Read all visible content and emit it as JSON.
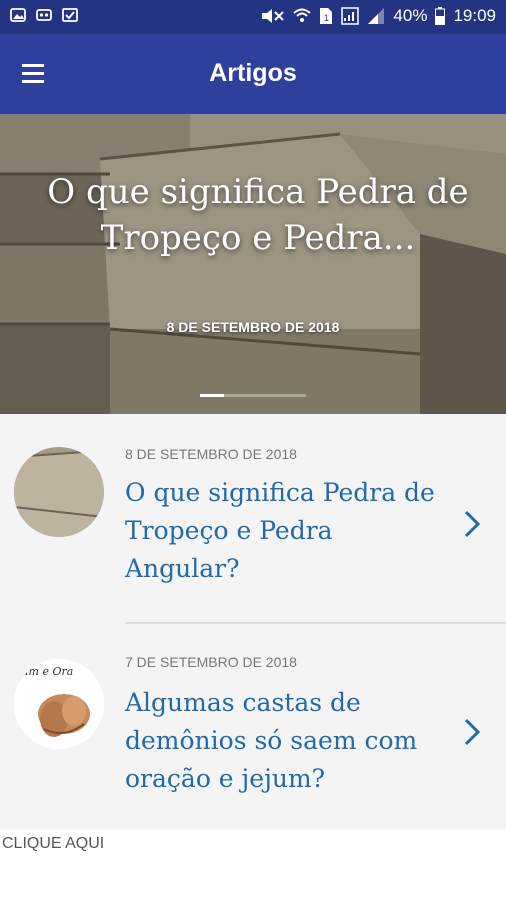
{
  "status_bar": {
    "battery_text": "40%",
    "time": "19:09"
  },
  "app_bar": {
    "title": "Artigos",
    "menu_icon": "hamburger-menu-icon"
  },
  "hero": {
    "title": "O que significa Pedra de Tropeço e Pedra...",
    "date": "8 DE SETEMBRO DE 2018"
  },
  "articles": [
    {
      "date": "8 DE SETEMBRO DE 2018",
      "title": "O que significa Pedra de Tropeço e Pedra Angular?"
    },
    {
      "date": "7 DE SETEMBRO DE 2018",
      "title": "Algumas castas de demônios só saem com oração e jejum?"
    }
  ],
  "footer": {
    "link_text": "CLIQUE AQUI"
  },
  "colors": {
    "status_bar": "#243382",
    "app_bar": "#2f3f9c",
    "link_blue": "#1f6aa8"
  }
}
